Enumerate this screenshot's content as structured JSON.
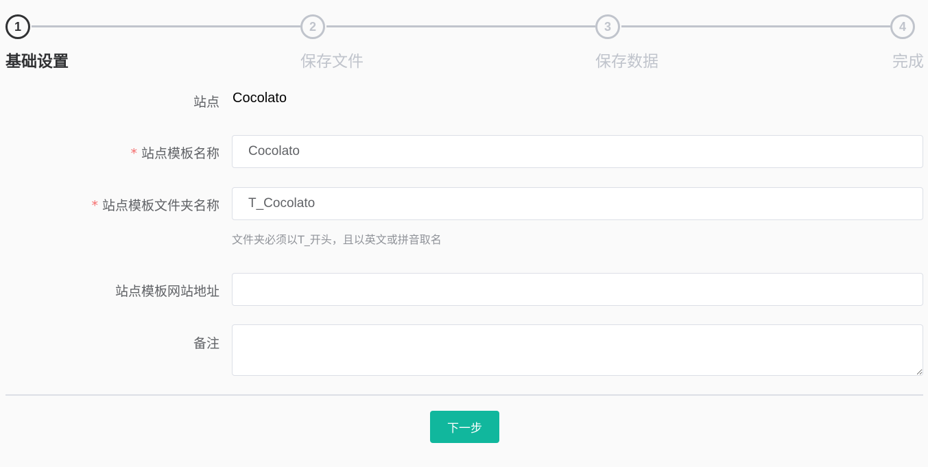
{
  "steps": [
    {
      "number": "1",
      "title": "基础设置"
    },
    {
      "number": "2",
      "title": "保存文件"
    },
    {
      "number": "3",
      "title": "保存数据"
    },
    {
      "number": "4",
      "title": "完成"
    }
  ],
  "form": {
    "site": {
      "label": "站点",
      "value": "Cocolato"
    },
    "template_name": {
      "required_mark": "*",
      "label": "站点模板名称",
      "value": "Cocolato"
    },
    "folder_name": {
      "required_mark": "*",
      "label": "站点模板文件夹名称",
      "value": "T_Cocolato",
      "hint": "文件夹必须以T_开头，且以英文或拼音取名"
    },
    "website_url": {
      "label": "站点模板网站地址",
      "value": ""
    },
    "remark": {
      "label": "备注",
      "value": ""
    }
  },
  "actions": {
    "next_label": "下一步"
  },
  "colors": {
    "accent": "#11b79d",
    "active_step": "#303133",
    "inactive_step": "#c0c4cc",
    "required": "#f56c6c"
  }
}
